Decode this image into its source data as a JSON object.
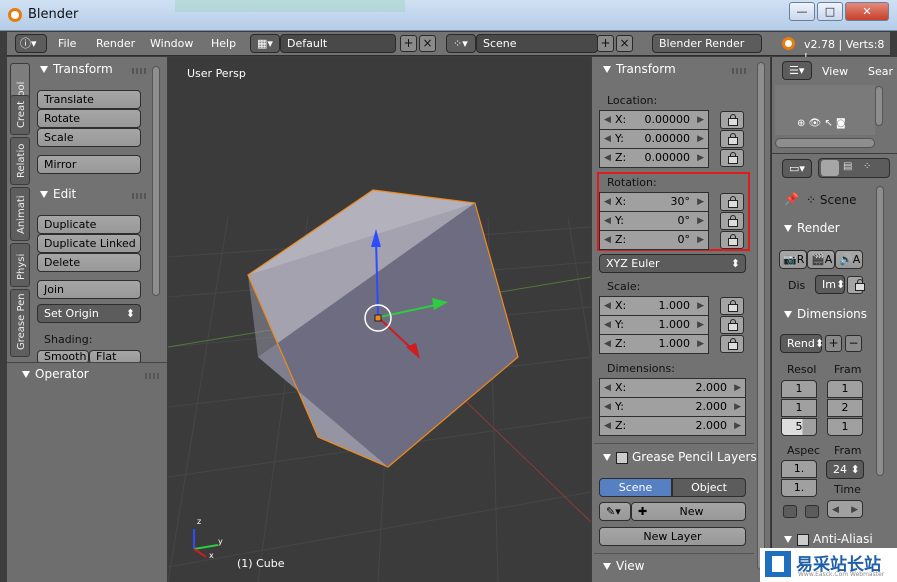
{
  "window": {
    "title": "Blender",
    "minimize": "—",
    "maximize": "□",
    "close": "✕"
  },
  "menubar": {
    "menus": [
      "File",
      "Render",
      "Window",
      "Help"
    ],
    "layout": "Default",
    "scene": "Scene",
    "engine": "Blender Render",
    "version": "v2.78 | Verts:8 |"
  },
  "toolshelf": {
    "tabs": [
      "Tool",
      "Creat",
      "Relatio",
      "Animati",
      "Physi",
      "Grease Pen"
    ],
    "transform_header": "Transform",
    "translate": "Translate",
    "rotate": "Rotate",
    "scale": "Scale",
    "mirror": "Mirror",
    "edit_header": "Edit",
    "duplicate": "Duplicate",
    "duplicate_linked": "Duplicate Linked",
    "delete": "Delete",
    "join": "Join",
    "set_origin": "Set Origin",
    "shading_label": "Shading:",
    "smooth": "Smooth",
    "flat": "Flat",
    "operator_header": "Operator"
  },
  "viewport": {
    "view_label": "User Persp",
    "object_label": "(1) Cube",
    "axis_x": "x",
    "axis_y": "y",
    "axis_z": "z"
  },
  "properties": {
    "transform_header": "Transform",
    "location_label": "Location:",
    "location": {
      "x": "0.00000",
      "y": "0.00000",
      "z": "0.00000"
    },
    "rotation_label": "Rotation:",
    "rotation": {
      "x": "30°",
      "y": "0°",
      "z": "0°"
    },
    "rotation_mode": "XYZ Euler",
    "scale_label": "Scale:",
    "scale": {
      "x": "1.000",
      "y": "1.000",
      "z": "1.000"
    },
    "dimensions_label": "Dimensions:",
    "dimensions": {
      "x": "2.000",
      "y": "2.000",
      "z": "2.000"
    },
    "axis_labels": {
      "x": "X:",
      "y": "Y:",
      "z": "Z:"
    },
    "grease_header": "Grease Pencil Layers",
    "scene_tab": "Scene",
    "object_tab": "Object",
    "new_btn": "New",
    "new_layer": "New Layer",
    "view_header": "View"
  },
  "outliner": {
    "view_menu": "View",
    "search_menu": "Sear"
  },
  "render_props": {
    "scene_label": "Scene",
    "render_header": "Render",
    "render_btn": "R",
    "anim_btn": "A",
    "audio_btn": "A",
    "display_label": "Dis",
    "display_value": "Im",
    "dimensions_header": "Dimensions",
    "preset": "Rend",
    "resolution_label": "Resol",
    "frame_label": "Fram",
    "res_values": [
      "1",
      "1",
      "5"
    ],
    "frame_values": [
      "1",
      "2",
      "1"
    ],
    "aspect_label": "Aspec",
    "frame_rate_label": "Fram",
    "aspect_values": [
      "1.",
      "1."
    ],
    "fps": "24",
    "time_label": "Time",
    "aa_header": "Anti-Aliasi"
  },
  "watermark": {
    "text": "易采站长站",
    "sub": "Www.Easck.Com Webmaster"
  },
  "colors": {
    "highlight": "#e01b1b",
    "selected_outline": "#f08a1c",
    "active_tab": "#5680c2"
  }
}
